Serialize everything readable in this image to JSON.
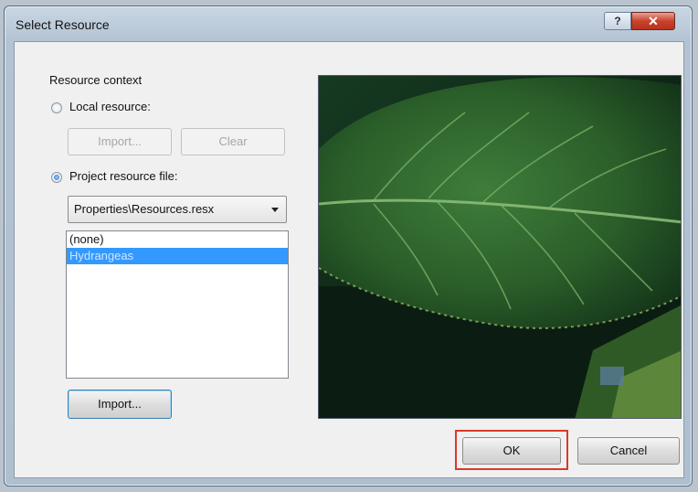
{
  "window": {
    "title": "Select Resource",
    "help_glyph": "?",
    "close_glyph": "✕"
  },
  "resource_context": {
    "group_label": "Resource context",
    "local_resource_label": "Local resource:",
    "local_resource_selected": false,
    "local_import_label": "Import...",
    "local_clear_label": "Clear",
    "project_resource_label": "Project resource file:",
    "project_resource_selected": true,
    "resource_file_value": "Properties\\Resources.resx",
    "list_items": [
      "(none)",
      "Hydrangeas"
    ],
    "selected_index": 1,
    "project_import_label": "Import..."
  },
  "preview": {
    "image_name": "Hydrangeas",
    "image_subject": "green leaf close-up"
  },
  "footer": {
    "ok_label": "OK",
    "cancel_label": "Cancel",
    "ok_highlight_color": "#d9392a"
  },
  "colors": {
    "selection": "#3399ff",
    "window_frame": "#b3c3d3",
    "close_button": "#c9432c"
  }
}
